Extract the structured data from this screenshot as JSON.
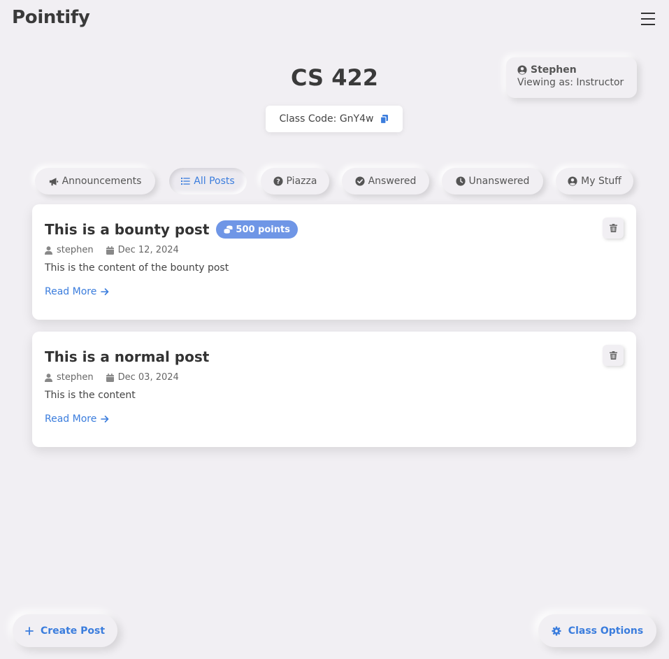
{
  "app": {
    "brand": "Pointify"
  },
  "user": {
    "name": "Stephen",
    "role_text": "Viewing as: Instructor"
  },
  "course": {
    "title": "CS 422",
    "class_code_text": "Class Code: GnY4w"
  },
  "tabs": [
    {
      "label": "Announcements",
      "icon": "megaphone-icon",
      "active": false
    },
    {
      "label": "All Posts",
      "icon": "list-icon",
      "active": true
    },
    {
      "label": "Piazza",
      "icon": "question-circle-icon",
      "active": false
    },
    {
      "label": "Answered",
      "icon": "check-circle-icon",
      "active": false
    },
    {
      "label": "Unanswered",
      "icon": "clock-icon",
      "active": false
    },
    {
      "label": "My Stuff",
      "icon": "user-circle-icon",
      "active": false
    }
  ],
  "posts": [
    {
      "title": "This is a bounty post",
      "bounty": "500 points",
      "author": "stephen",
      "date": "Dec 12, 2024",
      "content": "This is the content of the bounty post",
      "read_more": "Read More"
    },
    {
      "title": "This is a normal post",
      "author": "stephen",
      "date": "Dec 03, 2024",
      "content": "This is the content",
      "read_more": "Read More"
    }
  ],
  "actions": {
    "create_post": "Create Post",
    "class_options": "Class Options"
  },
  "colors": {
    "accent": "#3b7ddd",
    "background": "#f1eff3",
    "badge": "#6f96e6",
    "text": "#333333"
  }
}
